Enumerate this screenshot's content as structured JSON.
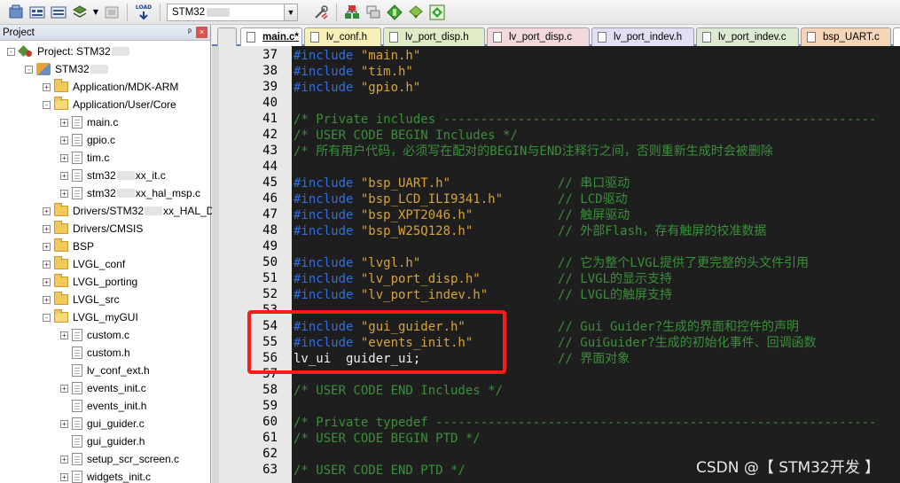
{
  "toolbar": {
    "target_name": "STM32",
    "load_label": "LOAD"
  },
  "project_panel": {
    "title": "Project",
    "pin_glyph": "ᵖ",
    "close_glyph": "×",
    "tree": [
      {
        "label": "Project: STM32",
        "kind": "project",
        "expander": "-",
        "blur": true
      },
      {
        "label": "STM32",
        "kind": "target",
        "expander": "-",
        "blur": true
      },
      {
        "label": "Application/MDK-ARM",
        "kind": "folder",
        "expander": "+"
      },
      {
        "label": "Application/User/Core",
        "kind": "folder-open",
        "expander": "-"
      },
      {
        "label": "main.c",
        "kind": "file",
        "expander": "+"
      },
      {
        "label": "gpio.c",
        "kind": "file",
        "expander": "+"
      },
      {
        "label": "tim.c",
        "kind": "file",
        "expander": "+"
      },
      {
        "label": "stm32",
        "label2": "xx_it.c",
        "kind": "file",
        "expander": "+",
        "blur": true
      },
      {
        "label": "stm32",
        "label2": "xx_hal_msp.c",
        "kind": "file",
        "expander": "+",
        "blur": true
      },
      {
        "label": "Drivers/STM32",
        "label2": "xx_HAL_Driv",
        "kind": "folder",
        "expander": "+",
        "blur": true
      },
      {
        "label": "Drivers/CMSIS",
        "kind": "folder",
        "expander": "+"
      },
      {
        "label": "BSP",
        "kind": "folder",
        "expander": "+"
      },
      {
        "label": "LVGL_conf",
        "kind": "folder",
        "expander": "+"
      },
      {
        "label": "LVGL_porting",
        "kind": "folder",
        "expander": "+"
      },
      {
        "label": "LVGL_src",
        "kind": "folder",
        "expander": "+"
      },
      {
        "label": "LVGL_myGUI",
        "kind": "folder-open",
        "expander": "-"
      },
      {
        "label": "custom.c",
        "kind": "file",
        "expander": "+"
      },
      {
        "label": "custom.h",
        "kind": "file",
        "expander": ""
      },
      {
        "label": "lv_conf_ext.h",
        "kind": "file",
        "expander": ""
      },
      {
        "label": "events_init.c",
        "kind": "file",
        "expander": "+"
      },
      {
        "label": "events_init.h",
        "kind": "file",
        "expander": ""
      },
      {
        "label": "gui_guider.c",
        "kind": "file",
        "expander": "+"
      },
      {
        "label": "gui_guider.h",
        "kind": "file",
        "expander": ""
      },
      {
        "label": "setup_scr_screen.c",
        "kind": "file",
        "expander": "+"
      },
      {
        "label": "widgets_init.c",
        "kind": "file",
        "expander": "+"
      }
    ]
  },
  "tabs": [
    {
      "label": "main.c*",
      "active": true,
      "color": "#ffffff"
    },
    {
      "label": "lv_conf.h",
      "active": false,
      "color": "#f6f0b8"
    },
    {
      "label": "lv_port_disp.h",
      "active": false,
      "color": "#e0ecc8"
    },
    {
      "label": "lv_port_disp.c",
      "active": false,
      "color": "#f3d8dc"
    },
    {
      "label": "lv_port_indev.h",
      "active": false,
      "color": "#e3dff2"
    },
    {
      "label": "lv_port_indev.c",
      "active": false,
      "color": "#dde9d3"
    },
    {
      "label": "bsp_UART.c",
      "active": false,
      "color": "#f5d5b8"
    }
  ],
  "code_lines": [
    {
      "n": "37",
      "segs": [
        [
          "kw",
          "#include "
        ],
        [
          "str",
          "\"main.h\""
        ]
      ]
    },
    {
      "n": "38",
      "segs": [
        [
          "kw",
          "#include "
        ],
        [
          "str",
          "\"tim.h\""
        ]
      ]
    },
    {
      "n": "39",
      "segs": [
        [
          "kw",
          "#include "
        ],
        [
          "str",
          "\"gpio.h\""
        ]
      ]
    },
    {
      "n": "40",
      "segs": []
    },
    {
      "n": "41",
      "segs": [
        [
          "cmt",
          "/* Private includes ----------------------------------------------------------"
        ]
      ]
    },
    {
      "n": "42",
      "segs": [
        [
          "cmt",
          "/* USER CODE BEGIN Includes */"
        ]
      ]
    },
    {
      "n": "43",
      "segs": [
        [
          "cmt",
          "/* 所有用户代码，必须写在配对的BEGIN与END注释行之间，否则重新生成时会被删除"
        ]
      ]
    },
    {
      "n": "44",
      "segs": []
    },
    {
      "n": "45",
      "segs": [
        [
          "kw",
          "#include "
        ],
        [
          "str",
          "\"bsp_UART.h\""
        ]
      ],
      "c": "// 串口驱动"
    },
    {
      "n": "46",
      "segs": [
        [
          "kw",
          "#include "
        ],
        [
          "str",
          "\"bsp_LCD_ILI9341.h\""
        ]
      ],
      "c": "// LCD驱动"
    },
    {
      "n": "47",
      "segs": [
        [
          "kw",
          "#include "
        ],
        [
          "str",
          "\"bsp_XPT2046.h\""
        ]
      ],
      "c": "// 触屏驱动"
    },
    {
      "n": "48",
      "segs": [
        [
          "kw",
          "#include "
        ],
        [
          "str",
          "\"bsp_W25Q128.h\""
        ]
      ],
      "c": "// 外部Flash，存有触屏的校准数据"
    },
    {
      "n": "49",
      "segs": []
    },
    {
      "n": "50",
      "segs": [
        [
          "kw",
          "#include "
        ],
        [
          "str",
          "\"lvgl.h\""
        ]
      ],
      "c": "// 它为整个LVGL提供了更完整的头文件引用"
    },
    {
      "n": "51",
      "segs": [
        [
          "kw",
          "#include "
        ],
        [
          "str",
          "\"lv_port_disp.h\""
        ]
      ],
      "c": "// LVGL的显示支持"
    },
    {
      "n": "52",
      "segs": [
        [
          "kw",
          "#include "
        ],
        [
          "str",
          "\"lv_port_indev.h\""
        ]
      ],
      "c": "// LVGL的触屏支持"
    },
    {
      "n": "53",
      "segs": []
    },
    {
      "n": "54",
      "segs": [
        [
          "kw",
          "#include "
        ],
        [
          "str",
          "\"gui_guider.h\""
        ]
      ],
      "c": "// Gui Guider?生成的界面和控件的声明"
    },
    {
      "n": "55",
      "segs": [
        [
          "kw",
          "#include "
        ],
        [
          "str",
          "\"events_init.h\""
        ]
      ],
      "c": "// GuiGuider?生成的初始化事件、回调函数"
    },
    {
      "n": "56",
      "segs": [
        [
          "plain",
          "lv_ui  guider_ui;"
        ]
      ],
      "c": "// 界面对象"
    },
    {
      "n": "57",
      "segs": []
    },
    {
      "n": "58",
      "segs": [
        [
          "cmt",
          "/* USER CODE END Includes */"
        ]
      ]
    },
    {
      "n": "59",
      "segs": []
    },
    {
      "n": "60",
      "segs": [
        [
          "cmt",
          "/* Private typedef -----------------------------------------------------------"
        ]
      ]
    },
    {
      "n": "61",
      "segs": [
        [
          "cmt",
          "/* USER CODE BEGIN PTD */"
        ]
      ]
    },
    {
      "n": "62",
      "segs": []
    },
    {
      "n": "63",
      "segs": [
        [
          "cmt",
          "/* USER CODE END PTD */"
        ]
      ]
    }
  ],
  "watermark": "CSDN @【 STM32开发 】",
  "colors": {
    "editor_bg": "#1e1e1e",
    "keyword": "#2f6fe0",
    "string": "#d8a33a",
    "comment": "#3a8f3a",
    "highlight_box": "#ff1a1a"
  }
}
